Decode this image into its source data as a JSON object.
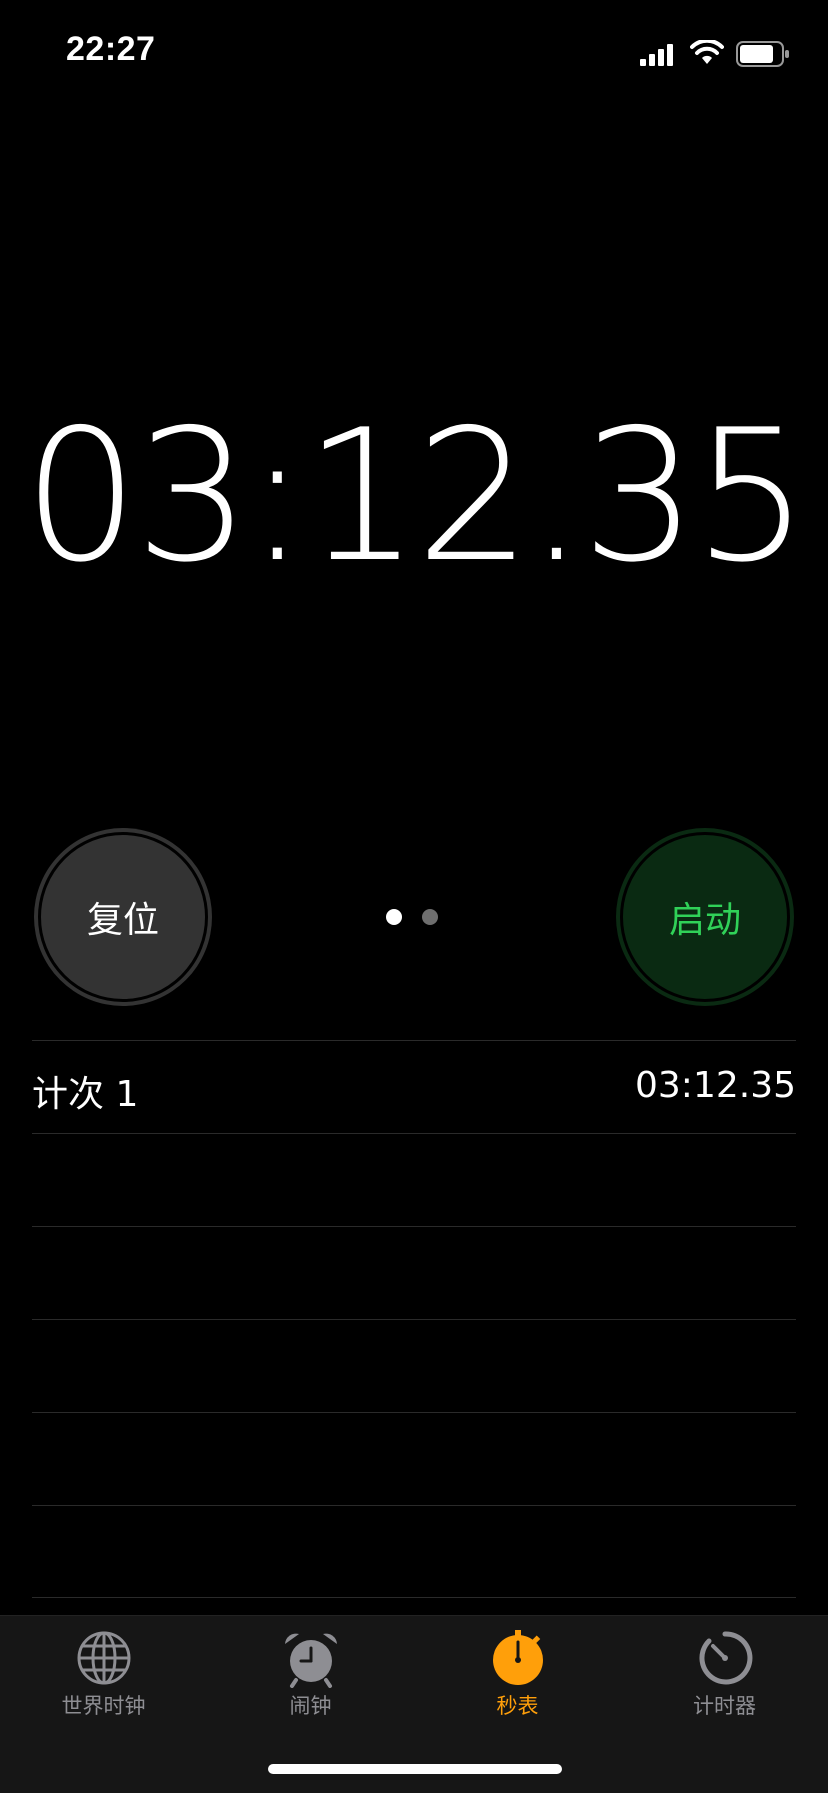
{
  "status_bar": {
    "time": "22:27",
    "icons": [
      "cellular-signal-icon",
      "wifi-icon",
      "battery-icon"
    ]
  },
  "stopwatch": {
    "display": "03:12.35",
    "reset_label": "复位",
    "start_label": "启动",
    "page_dots": {
      "count": 2,
      "active_index": 0
    }
  },
  "laps": [
    {
      "label": "计次 1",
      "time": "03:12.35"
    },
    {
      "label": "",
      "time": ""
    },
    {
      "label": "",
      "time": ""
    },
    {
      "label": "",
      "time": ""
    },
    {
      "label": "",
      "time": ""
    },
    {
      "label": "",
      "time": ""
    }
  ],
  "tabs": [
    {
      "label": "世界时钟",
      "icon": "globe-icon",
      "active": false
    },
    {
      "label": "闹钟",
      "icon": "alarm-clock-icon",
      "active": false
    },
    {
      "label": "秒表",
      "icon": "stopwatch-icon",
      "active": true
    },
    {
      "label": "计时器",
      "icon": "timer-icon",
      "active": false
    }
  ],
  "colors": {
    "background": "#000000",
    "accent": "#ff9f0a",
    "start_green": "#30d158",
    "inactive_gray": "#8e8e93"
  }
}
